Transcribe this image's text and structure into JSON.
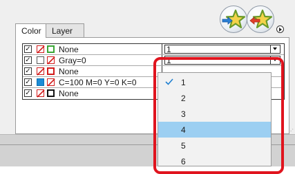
{
  "tabs": [
    {
      "label": "Color",
      "active": true
    },
    {
      "label": "Layer",
      "active": false
    }
  ],
  "rows": [
    {
      "checked": true,
      "name": "None",
      "value": "1",
      "swatch1": "none",
      "swatch2": "green-square"
    },
    {
      "checked": true,
      "name": "Gray=0",
      "value": "1",
      "swatch1": "empty",
      "swatch2": "none"
    },
    {
      "checked": true,
      "name": "None",
      "value": "",
      "swatch1": "none",
      "swatch2": "red-square"
    },
    {
      "checked": true,
      "name": "C=100 M=0 Y=0 K=0",
      "value": "",
      "swatch1": "blue",
      "swatch2": "none"
    },
    {
      "checked": true,
      "name": "None",
      "value": "",
      "swatch1": "none",
      "swatch2": "black-square"
    }
  ],
  "dropdown": {
    "options": [
      "1",
      "2",
      "3",
      "4",
      "5",
      "6"
    ],
    "checked": "1",
    "highlighted": "4"
  },
  "toolbar": {
    "icons": [
      "star-import-icon",
      "star-export-icon",
      "panel-menu-icon"
    ]
  },
  "colors": {
    "highlight_red": "#e0141e",
    "selection_blue": "#9ccff2",
    "check_blue": "#1e7fd0",
    "cyan_swatch": "#1c8cd6"
  }
}
